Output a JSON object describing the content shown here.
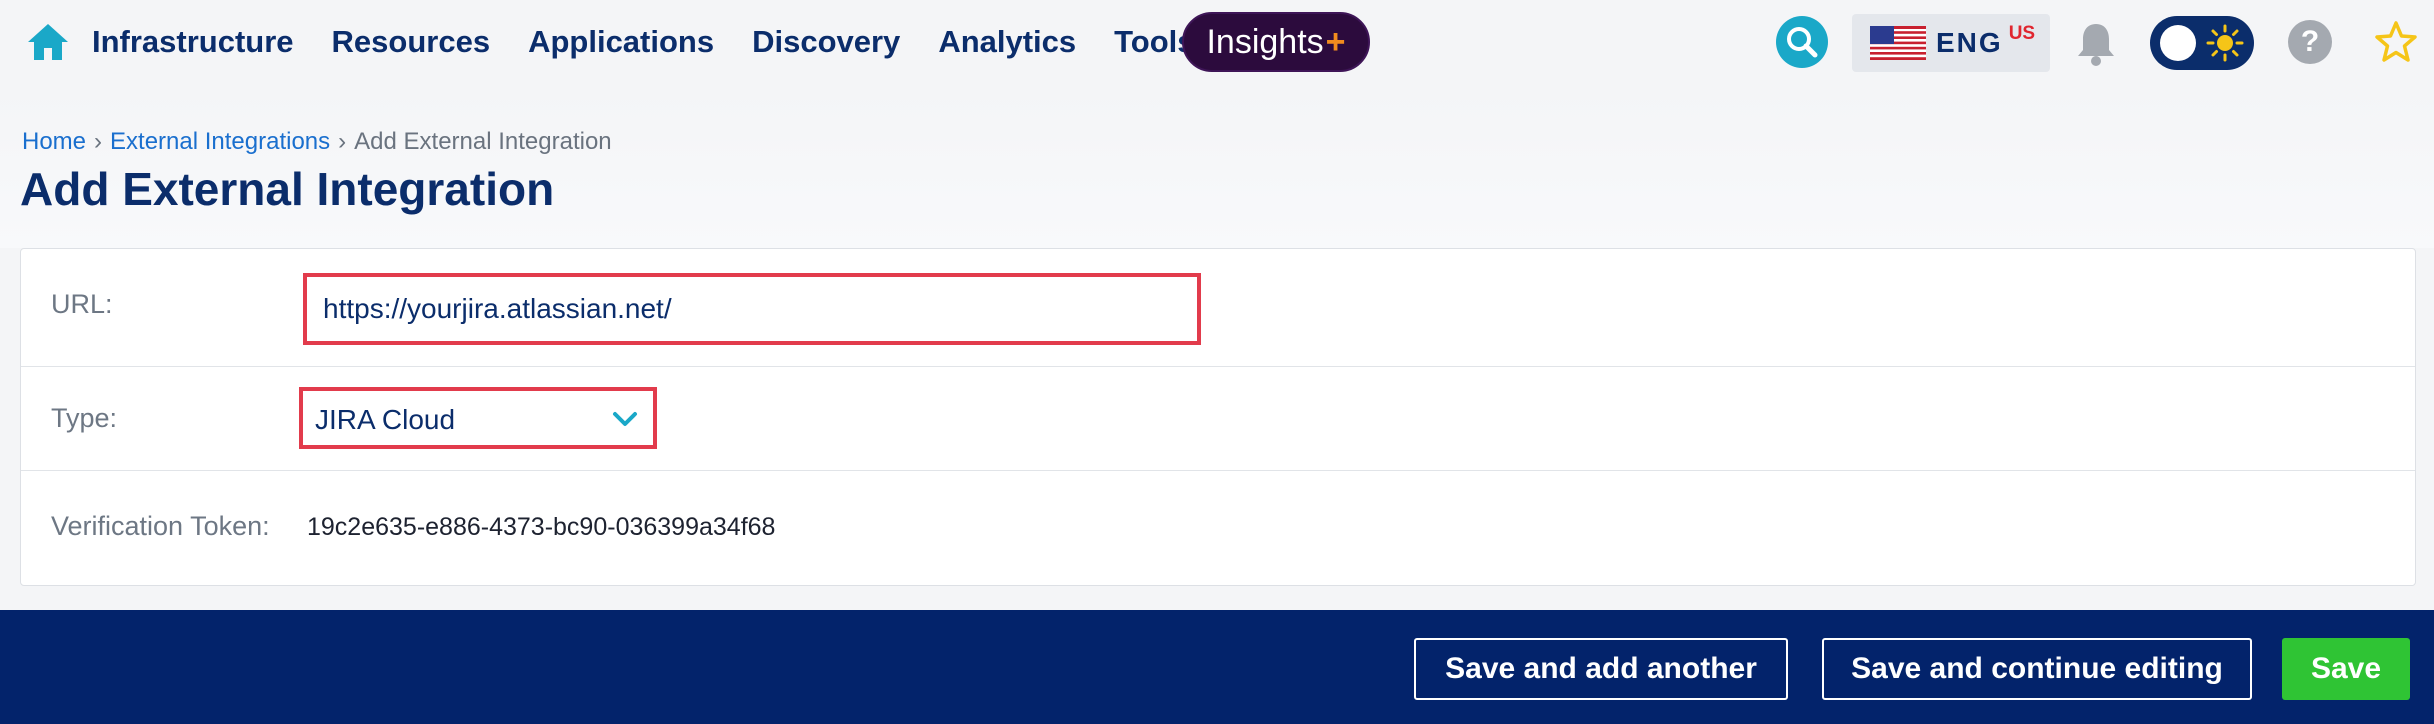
{
  "nav": {
    "items": [
      {
        "label": "Infrastructure"
      },
      {
        "label": "Resources"
      },
      {
        "label": "Applications"
      },
      {
        "label": "Discovery"
      },
      {
        "label": "Analytics"
      },
      {
        "label": "Tools"
      }
    ],
    "insights_label": "Insights",
    "insights_plus": "+",
    "language": "ENG",
    "language_region": "US",
    "help_symbol": "?",
    "icons": [
      "home-icon",
      "search-icon",
      "us-flag-icon",
      "bell-icon",
      "theme-toggle",
      "help-icon",
      "star-icon"
    ]
  },
  "breadcrumb": {
    "home": "Home",
    "parent": "External Integrations",
    "current": "Add External Integration",
    "separator": "›"
  },
  "page": {
    "title": "Add External Integration"
  },
  "form": {
    "url": {
      "label": "URL:",
      "value": "https://yourjira.atlassian.net/"
    },
    "type": {
      "label": "Type:",
      "value": "JIRA Cloud"
    },
    "token": {
      "label": "Verification Token:",
      "value": "19c2e635-e886-4373-bc90-036399a34f68"
    }
  },
  "actions": {
    "save_add_another": "Save and add another",
    "save_continue": "Save and continue editing",
    "save": "Save"
  },
  "colors": {
    "brand_navy": "#0b2d6b",
    "footer_navy": "#03236b",
    "save_green": "#2fc434",
    "highlight_red": "#e23b4c",
    "insights_purple": "#2c0b3d",
    "link_blue": "#1a6fce"
  }
}
